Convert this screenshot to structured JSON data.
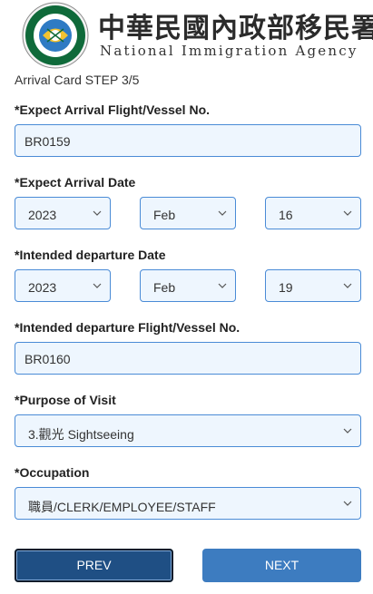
{
  "header": {
    "title_zh": "中華民國內政部移民署",
    "title_en": "National Immigration Agency",
    "logo_icon": "agency-seal-icon"
  },
  "step_label": "Arrival Card STEP 3/5",
  "form": {
    "flight": {
      "label": "*Expect Arrival Flight/Vessel No.",
      "value": "BR0159"
    },
    "arrival_date": {
      "label": "*Expect Arrival Date",
      "year": "2023",
      "month": "Feb",
      "day": "16"
    },
    "departure_date": {
      "label": "*Intended departure Date",
      "year": "2023",
      "month": "Feb",
      "day": "19"
    },
    "departure_flight": {
      "label": "*Intended departure Flight/Vessel No.",
      "value": "BR0160"
    },
    "purpose": {
      "label": "*Purpose of Visit",
      "value": "3.觀光 Sightseeing"
    },
    "occupation": {
      "label": "*Occupation",
      "value": "職員/CLERK/EMPLOYEE/STAFF"
    }
  },
  "buttons": {
    "prev": "PREV",
    "next": "NEXT"
  },
  "colors": {
    "field_border": "#4a8bd6",
    "field_bg": "#eef6fe",
    "prev_bg": "#1f4f84",
    "next_bg": "#3d7cc0"
  }
}
